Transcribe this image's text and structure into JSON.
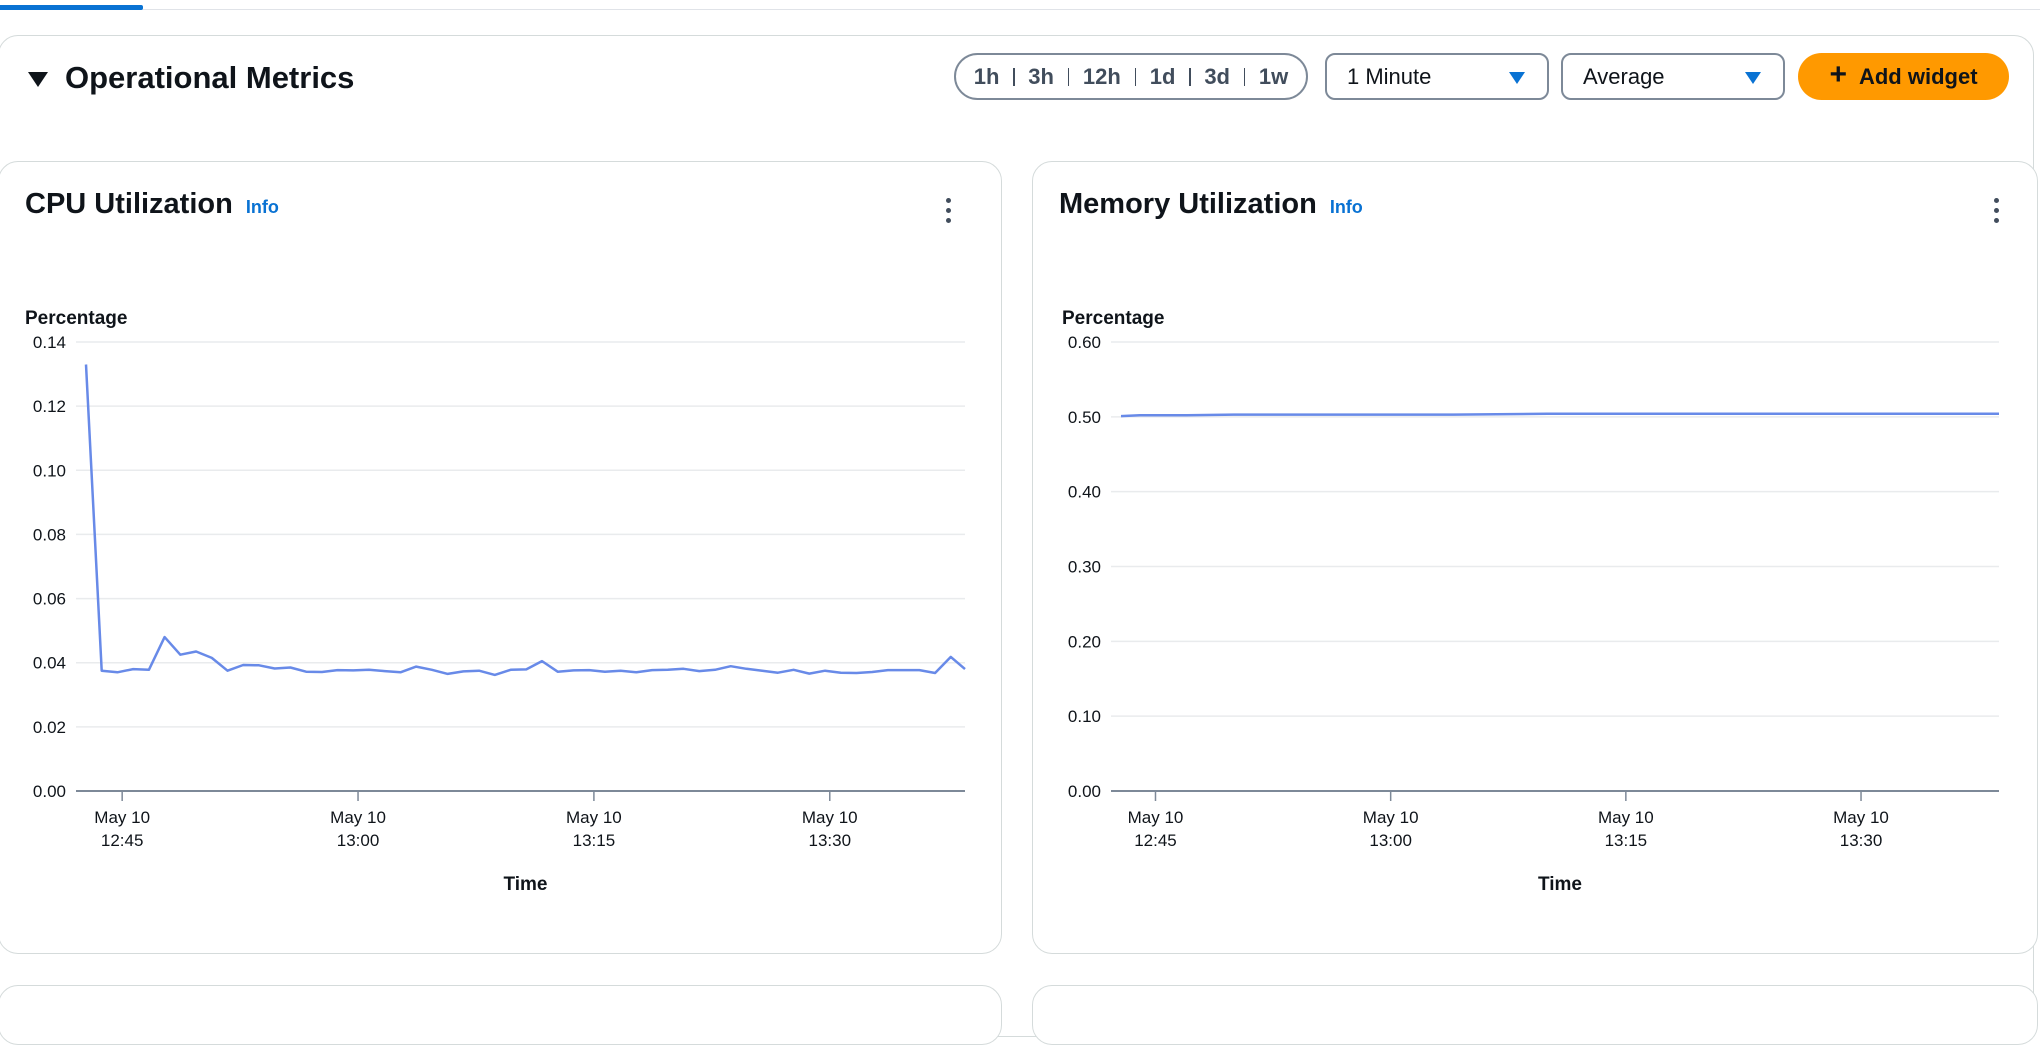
{
  "section": {
    "title": "Operational Metrics"
  },
  "time_ranges": [
    "1h",
    "3h",
    "12h",
    "1d",
    "3d",
    "1w"
  ],
  "period_dropdown": {
    "value": "1 Minute"
  },
  "stat_dropdown": {
    "value": "Average"
  },
  "add_widget": {
    "label": "Add widget"
  },
  "colors": {
    "accent_blue": "#0972d3",
    "series_line": "#688ae8",
    "primary_button": "#ff9900",
    "grid": "#e9ebed"
  },
  "panels": [
    {
      "title": "CPU Utilization",
      "info": "Info"
    },
    {
      "title": "Memory Utilization",
      "info": "Info"
    }
  ],
  "chart_data": [
    {
      "type": "line",
      "title": "CPU Utilization",
      "ylabel": "Percentage",
      "xlabel": "Time",
      "ylim": [
        0,
        0.14
      ],
      "y_ticks": [
        "0.14",
        "0.12",
        "0.10",
        "0.08",
        "0.06",
        "0.04",
        "0.02",
        "0.00"
      ],
      "x_ticks": [
        {
          "minute": 45,
          "date": "May 10",
          "time": "12:45"
        },
        {
          "minute": 60,
          "date": "May 10",
          "time": "13:00"
        },
        {
          "minute": 75,
          "date": "May 10",
          "time": "13:15"
        },
        {
          "minute": 90,
          "date": "May 10",
          "time": "13:30"
        }
      ],
      "x_minutes_range": [
        42.7,
        98.6
      ],
      "grid": true,
      "legend": "none",
      "series": [
        {
          "x_minutes": [
            42.7,
            43.7,
            44.7,
            45.7,
            46.7,
            47.7,
            48.7,
            49.7,
            50.7,
            51.7,
            52.7,
            53.7,
            54.7,
            55.7,
            56.7,
            57.7,
            58.7,
            59.7,
            60.7,
            61.7,
            62.7,
            63.7,
            64.7,
            65.7,
            66.7,
            67.7,
            68.7,
            69.7,
            70.7,
            71.7,
            72.7,
            73.7,
            74.7,
            75.7,
            76.7,
            77.7,
            78.7,
            79.7,
            80.7,
            81.7,
            82.7,
            83.7,
            84.7,
            85.7,
            86.7,
            87.7,
            88.7,
            89.7,
            90.7,
            91.7,
            92.7,
            93.7,
            94.7,
            95.7,
            96.7,
            97.7,
            98.6
          ],
          "values": [
            0.133,
            0.0375,
            0.037,
            0.038,
            0.0378,
            0.048,
            0.0425,
            0.0435,
            0.0415,
            0.0375,
            0.0393,
            0.0392,
            0.0382,
            0.0385,
            0.0372,
            0.0371,
            0.0377,
            0.0376,
            0.0378,
            0.0374,
            0.037,
            0.0388,
            0.0378,
            0.0365,
            0.0373,
            0.0375,
            0.0362,
            0.0378,
            0.0379,
            0.0405,
            0.0372,
            0.0376,
            0.0377,
            0.0372,
            0.0375,
            0.037,
            0.0377,
            0.0378,
            0.0381,
            0.0374,
            0.0378,
            0.0389,
            0.0381,
            0.0375,
            0.0369,
            0.0378,
            0.0366,
            0.0375,
            0.0369,
            0.0368,
            0.0371,
            0.0377,
            0.0377,
            0.0377,
            0.0368,
            0.0418,
            0.038
          ]
        }
      ]
    },
    {
      "type": "line",
      "title": "Memory Utilization",
      "ylabel": "Percentage",
      "xlabel": "Time",
      "ylim": [
        0,
        0.6
      ],
      "y_ticks": [
        "0.60",
        "0.50",
        "0.40",
        "0.30",
        "0.20",
        "0.10",
        "0.00"
      ],
      "x_ticks": [
        {
          "minute": 45,
          "date": "May 10",
          "time": "12:45"
        },
        {
          "minute": 60,
          "date": "May 10",
          "time": "13:00"
        },
        {
          "minute": 75,
          "date": "May 10",
          "time": "13:15"
        },
        {
          "minute": 90,
          "date": "May 10",
          "time": "13:30"
        }
      ],
      "x_minutes_range": [
        42.8,
        98.8
      ],
      "grid": true,
      "legend": "none",
      "series": [
        {
          "x_minutes": [
            42.8,
            44,
            47,
            50,
            55,
            60,
            64,
            70,
            80,
            90,
            98.8
          ],
          "values": [
            0.501,
            0.502,
            0.502,
            0.503,
            0.503,
            0.503,
            0.503,
            0.504,
            0.504,
            0.504,
            0.504
          ]
        }
      ]
    }
  ]
}
